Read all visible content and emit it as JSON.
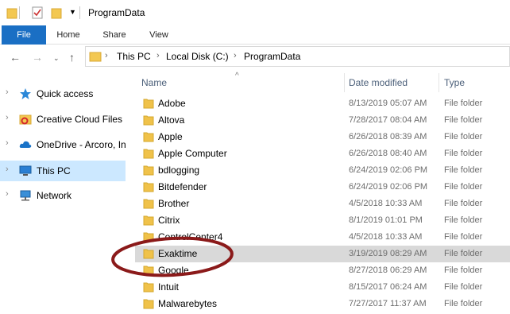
{
  "window": {
    "title": "ProgramData"
  },
  "ribbon": {
    "tabs": [
      "File",
      "Home",
      "Share",
      "View"
    ]
  },
  "address": {
    "crumbs": [
      "This PC",
      "Local Disk (C:)",
      "ProgramData"
    ]
  },
  "nav": {
    "items": [
      {
        "label": "Quick access",
        "icon": "star-icon"
      },
      {
        "label": "Creative Cloud Files",
        "icon": "creative-cloud-icon"
      },
      {
        "label": "OneDrive - Arcoro, In",
        "icon": "cloud-icon"
      },
      {
        "label": "This PC",
        "icon": "computer-icon",
        "selected": true
      },
      {
        "label": "Network",
        "icon": "network-icon"
      }
    ]
  },
  "columns": {
    "name": "Name",
    "date": "Date modified",
    "type": "Type"
  },
  "files": [
    {
      "name": "Adobe",
      "date": "8/13/2019 05:07 AM",
      "type": "File folder"
    },
    {
      "name": "Altova",
      "date": "7/28/2017 08:04 AM",
      "type": "File folder"
    },
    {
      "name": "Apple",
      "date": "6/26/2018 08:39 AM",
      "type": "File folder"
    },
    {
      "name": "Apple Computer",
      "date": "6/26/2018 08:40 AM",
      "type": "File folder"
    },
    {
      "name": "bdlogging",
      "date": "6/24/2019 02:06 PM",
      "type": "File folder"
    },
    {
      "name": "Bitdefender",
      "date": "6/24/2019 02:06 PM",
      "type": "File folder"
    },
    {
      "name": "Brother",
      "date": "4/5/2018 10:33 AM",
      "type": "File folder"
    },
    {
      "name": "Citrix",
      "date": "8/1/2019 01:01 PM",
      "type": "File folder"
    },
    {
      "name": "ControlCenter4",
      "date": "4/5/2018 10:33 AM",
      "type": "File folder"
    },
    {
      "name": "Exaktime",
      "date": "3/19/2019 08:29 AM",
      "type": "File folder",
      "highlighted": true
    },
    {
      "name": "Google",
      "date": "8/27/2018 06:29 AM",
      "type": "File folder"
    },
    {
      "name": "Intuit",
      "date": "8/15/2017 06:24 AM",
      "type": "File folder"
    },
    {
      "name": "Malwarebytes",
      "date": "7/27/2017 11:37 AM",
      "type": "File folder"
    }
  ],
  "colors": {
    "accent": "#1a6fc4",
    "selected": "#cce8ff",
    "highlight": "#d9d9d9",
    "folder": "#f0c24a",
    "annotation": "#8b1a1a"
  }
}
